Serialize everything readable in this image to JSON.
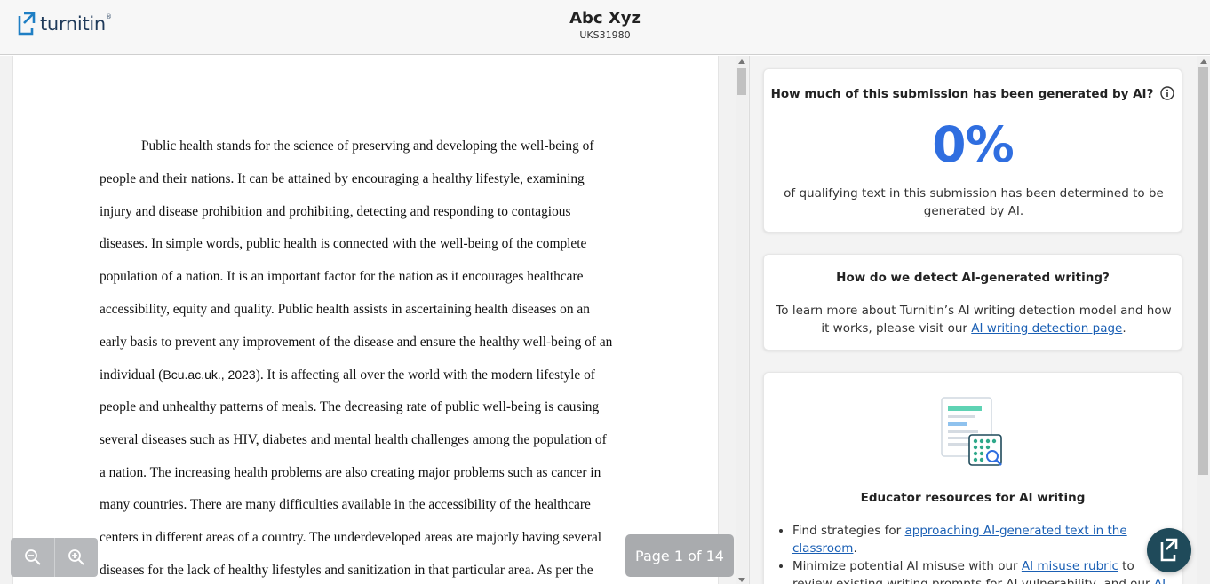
{
  "header": {
    "logo_text": "turnitin",
    "logo_tm": "®",
    "student_name": "Abc Xyz",
    "submission_id": "UKS31980"
  },
  "document": {
    "lines": [
      {
        "text": "Public health stands for the science of preserving and developing the well-being of",
        "indent": true
      },
      {
        "text": "people and their nations. It can be attained by encouraging a healthy lifestyle, examining"
      },
      {
        "text": "injury and disease prohibition and prohibiting, detecting and responding to contagious"
      },
      {
        "text": "diseases. In simple words, public health is connected with the well-being of the complete"
      },
      {
        "text": "population of a nation. It is an important factor for the nation as it encourages healthcare"
      },
      {
        "text": "accessibility, equity and quality. Public health assists in ascertaining health diseases on an"
      },
      {
        "text": "early basis to prevent any improvement of the disease and ensure the healthy well-being of an"
      },
      {
        "pre": "individual (",
        "cite": "Bcu.ac.uk., 2023",
        "post": "). It is affecting all over the world with the modern lifestyle of"
      },
      {
        "text": "people and unhealthy patterns of meals. The decreasing rate of public well-being is causing"
      },
      {
        "text": "several diseases such as HIV, diabetes and mental health challenges among the population of"
      },
      {
        "text": "a nation. The increasing health problems are also creating major problems such as cancer in"
      },
      {
        "text": "many countries. There are many difficulties available in the accessibility of the healthcare"
      },
      {
        "text": "centers in different areas of a country. The underdeveloped areas are majorly having several"
      },
      {
        "text": "diseases for the lack of healthy lifestyles and sanitization in that particular area. As per the"
      }
    ]
  },
  "viewer": {
    "page_indicator": "Page 1 of 14",
    "zoom_out_icon": "zoom-out-icon",
    "zoom_in_icon": "zoom-in-icon"
  },
  "ai_panel": {
    "question": "How much of this submission has been generated by AI?",
    "percentage": "0%",
    "percentage_desc": "of qualifying text in this submission has been determined to be generated by AI.",
    "detect_title": "How do we detect AI-generated writing?",
    "detect_text_pre": "To learn more about Turnitin’s AI writing detection model and how it works, please visit our ",
    "detect_link": "AI writing detection page",
    "detect_text_post": ".",
    "edu_title": "Educator resources for AI writing",
    "edu_item1_pre": "Find strategies for ",
    "edu_item1_link": "approaching AI-generated text in the classroom",
    "edu_item1_post": ".",
    "edu_item2_pre": "Minimize potential AI misuse with our ",
    "edu_item2_link": "AI misuse rubric",
    "edu_item2_mid": " to review existing writing prompts for AI vulnerability, and our ",
    "edu_item2_link2": "AI misuse"
  },
  "colors": {
    "accent": "#2f6ee0",
    "link": "#1a5fb4",
    "brand": "#1f3a5a",
    "help_button": "#1f4a5a"
  }
}
